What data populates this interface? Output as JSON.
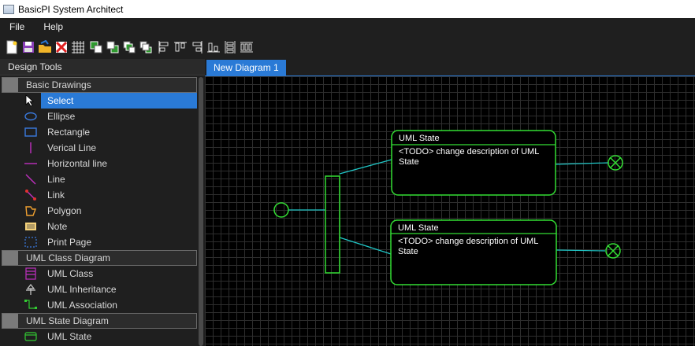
{
  "window": {
    "title": "BasicPI System Architect"
  },
  "menu": {
    "items": [
      "File",
      "Help"
    ]
  },
  "toolbar": {
    "icons": [
      "new-file-icon",
      "save-icon",
      "open-folder-icon",
      "delete-icon",
      "grid-icon",
      "bring-forward-icon",
      "send-backward-icon",
      "bring-to-front-icon",
      "send-to-back-icon",
      "align-left-icon",
      "align-top-icon",
      "align-right-icon",
      "align-bottom-icon",
      "distribute-vertical-icon",
      "distribute-horizontal-icon"
    ]
  },
  "left_panel": {
    "title": "Design Tools",
    "groups": [
      {
        "label": "Basic Drawings",
        "items": [
          {
            "label": "Select",
            "icon": "arrow-cursor-icon",
            "selected": true
          },
          {
            "label": "Ellipse",
            "icon": "ellipse-icon"
          },
          {
            "label": "Rectangle",
            "icon": "rectangle-icon"
          },
          {
            "label": "Verical Line",
            "icon": "vertical-line-icon"
          },
          {
            "label": "Horizontal line",
            "icon": "horizontal-line-icon"
          },
          {
            "label": "Line",
            "icon": "line-icon"
          },
          {
            "label": "Link",
            "icon": "link-icon"
          },
          {
            "label": "Polygon",
            "icon": "polygon-icon"
          },
          {
            "label": "Note",
            "icon": "note-icon"
          },
          {
            "label": "Print Page",
            "icon": "print-page-icon"
          }
        ]
      },
      {
        "label": "UML Class Diagram",
        "items": [
          {
            "label": "UML Class",
            "icon": "uml-class-icon"
          },
          {
            "label": "UML Inheritance",
            "icon": "uml-inheritance-icon"
          },
          {
            "label": "UML Association",
            "icon": "uml-association-icon"
          }
        ]
      },
      {
        "label": "UML State Diagram",
        "items": [
          {
            "label": "UML State",
            "icon": "uml-state-icon"
          }
        ]
      }
    ]
  },
  "tabs": [
    {
      "label": "New Diagram 1",
      "active": true
    }
  ],
  "diagram": {
    "states": [
      {
        "title": "UML State",
        "desc_line1": "<TODO> change description of UML",
        "desc_line2": "State"
      },
      {
        "title": "UML State",
        "desc_line1": "<TODO> change description of UML",
        "desc_line2": "State"
      }
    ],
    "colors": {
      "shape_stroke": "#33dd33",
      "connector": "#20c8c8",
      "grid": "#2e2e2e",
      "canvas": "#000000",
      "selection": "#2a7ad6"
    }
  }
}
